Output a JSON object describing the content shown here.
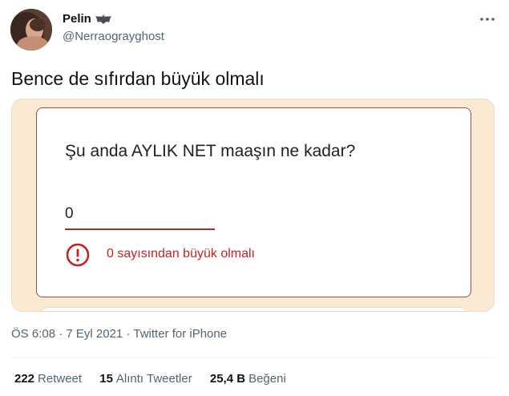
{
  "author": {
    "name": "Pelin",
    "handle": "@Nerraograyghost",
    "name_icon": "bat-icon"
  },
  "tweet": {
    "text": "Bence de sıfırdan büyük olmalı"
  },
  "media": {
    "question": "Şu anda AYLIK NET maaşın ne kadar?",
    "answer_value": "0",
    "error_message": "0 sayısından büyük olmalı",
    "accent_color": "#c5221f",
    "background_color": "#fbead3"
  },
  "meta": {
    "time": "ÖS 6:08",
    "date": "7 Eyl 2021",
    "source": "Twitter for iPhone",
    "separator": "·"
  },
  "stats": [
    {
      "count": "222",
      "label": "Retweet"
    },
    {
      "count": "15",
      "label": "Alıntı Tweetler"
    },
    {
      "count": "25,4 B",
      "label": "Beğeni"
    }
  ]
}
